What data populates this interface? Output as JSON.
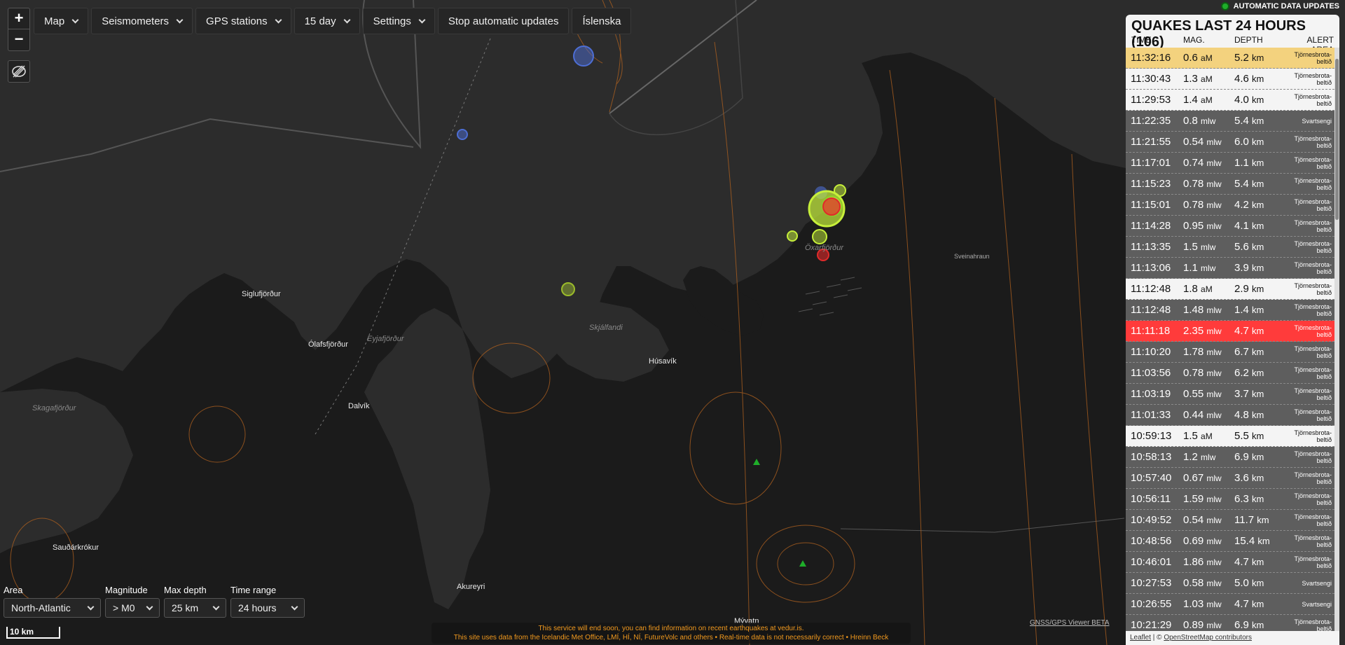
{
  "toolbar": {
    "zoom_in": "+",
    "zoom_out": "−",
    "buttons": [
      {
        "label": "Map",
        "dropdown": true
      },
      {
        "label": "Seismometers",
        "dropdown": true
      },
      {
        "label": "GPS stations",
        "dropdown": true
      },
      {
        "label": "15 day",
        "dropdown": true
      },
      {
        "label": "Settings",
        "dropdown": true
      },
      {
        "label": "Stop automatic updates",
        "dropdown": false
      },
      {
        "label": "Íslenska",
        "dropdown": false
      }
    ],
    "draw_icon": "draw-shape-icon"
  },
  "status": {
    "label": "AUTOMATIC DATA UPDATES",
    "color": "#1fae2a"
  },
  "panel": {
    "title": "QUAKES LAST 24 HOURS (106)",
    "columns": [
      "TIME",
      "MAG.",
      "DEPTH",
      "ALERT AREA"
    ],
    "rows": [
      {
        "time": "11:32:16",
        "mag": "0.6",
        "unit": "aM",
        "depth": "5.2",
        "area": "Tjörnesbrota-beltið",
        "style": "hl"
      },
      {
        "time": "11:30:43",
        "mag": "1.3",
        "unit": "aM",
        "depth": "4.6",
        "area": "Tjörnesbrota-beltið",
        "style": "light"
      },
      {
        "time": "11:29:53",
        "mag": "1.4",
        "unit": "aM",
        "depth": "4.0",
        "area": "Tjörnesbrota-beltið",
        "style": "light"
      },
      {
        "time": "11:22:35",
        "mag": "0.8",
        "unit": "mlw",
        "depth": "5.4",
        "area": "Svartsengi",
        "style": "dark"
      },
      {
        "time": "11:21:55",
        "mag": "0.54",
        "unit": "mlw",
        "depth": "6.0",
        "area": "Tjörnesbrota-beltið",
        "style": "dark"
      },
      {
        "time": "11:17:01",
        "mag": "0.74",
        "unit": "mlw",
        "depth": "1.1",
        "area": "Tjörnesbrota-beltið",
        "style": "dark"
      },
      {
        "time": "11:15:23",
        "mag": "0.78",
        "unit": "mlw",
        "depth": "5.4",
        "area": "Tjörnesbrota-beltið",
        "style": "dark"
      },
      {
        "time": "11:15:01",
        "mag": "0.78",
        "unit": "mlw",
        "depth": "4.2",
        "area": "Tjörnesbrota-beltið",
        "style": "dark"
      },
      {
        "time": "11:14:28",
        "mag": "0.95",
        "unit": "mlw",
        "depth": "4.1",
        "area": "Tjörnesbrota-beltið",
        "style": "dark"
      },
      {
        "time": "11:13:35",
        "mag": "1.5",
        "unit": "mlw",
        "depth": "5.6",
        "area": "Tjörnesbrota-beltið",
        "style": "dark"
      },
      {
        "time": "11:13:06",
        "mag": "1.1",
        "unit": "mlw",
        "depth": "3.9",
        "area": "Tjörnesbrota-beltið",
        "style": "dark"
      },
      {
        "time": "11:12:48",
        "mag": "1.8",
        "unit": "aM",
        "depth": "2.9",
        "area": "Tjörnesbrota-beltið",
        "style": "light"
      },
      {
        "time": "11:12:48",
        "mag": "1.48",
        "unit": "mlw",
        "depth": "1.4",
        "area": "Tjörnesbrota-beltið",
        "style": "dark"
      },
      {
        "time": "11:11:18",
        "mag": "2.35",
        "unit": "mlw",
        "depth": "4.7",
        "area": "Tjörnesbrota-beltið",
        "style": "red"
      },
      {
        "time": "11:10:20",
        "mag": "1.78",
        "unit": "mlw",
        "depth": "6.7",
        "area": "Tjörnesbrota-beltið",
        "style": "dark"
      },
      {
        "time": "11:03:56",
        "mag": "0.78",
        "unit": "mlw",
        "depth": "6.2",
        "area": "Tjörnesbrota-beltið",
        "style": "dark"
      },
      {
        "time": "11:03:19",
        "mag": "0.55",
        "unit": "mlw",
        "depth": "3.7",
        "area": "Tjörnesbrota-beltið",
        "style": "dark"
      },
      {
        "time": "11:01:33",
        "mag": "0.44",
        "unit": "mlw",
        "depth": "4.8",
        "area": "Tjörnesbrota-beltið",
        "style": "dark"
      },
      {
        "time": "10:59:13",
        "mag": "1.5",
        "unit": "aM",
        "depth": "5.5",
        "area": "Tjörnesbrota-beltið",
        "style": "light"
      },
      {
        "time": "10:58:13",
        "mag": "1.2",
        "unit": "mlw",
        "depth": "6.9",
        "area": "Tjörnesbrota-beltið",
        "style": "dark"
      },
      {
        "time": "10:57:40",
        "mag": "0.67",
        "unit": "mlw",
        "depth": "3.6",
        "area": "Tjörnesbrota-beltið",
        "style": "dark"
      },
      {
        "time": "10:56:11",
        "mag": "1.59",
        "unit": "mlw",
        "depth": "6.3",
        "area": "Tjörnesbrota-beltið",
        "style": "dark"
      },
      {
        "time": "10:49:52",
        "mag": "0.54",
        "unit": "mlw",
        "depth": "11.7",
        "area": "Tjörnesbrota-beltið",
        "style": "dark"
      },
      {
        "time": "10:48:56",
        "mag": "0.69",
        "unit": "mlw",
        "depth": "15.4",
        "area": "Tjörnesbrota-beltið",
        "style": "dark"
      },
      {
        "time": "10:46:01",
        "mag": "1.86",
        "unit": "mlw",
        "depth": "4.7",
        "area": "Tjörnesbrota-beltið",
        "style": "dark"
      },
      {
        "time": "10:27:53",
        "mag": "0.58",
        "unit": "mlw",
        "depth": "5.0",
        "area": "Svartsengi",
        "style": "dark"
      },
      {
        "time": "10:26:55",
        "mag": "1.03",
        "unit": "mlw",
        "depth": "4.7",
        "area": "Svartsengi",
        "style": "dark"
      },
      {
        "time": "10:21:29",
        "mag": "0.89",
        "unit": "mlw",
        "depth": "6.9",
        "area": "Tjörnesbrota-beltið",
        "style": "dark"
      }
    ],
    "depth_unit": "km"
  },
  "filters": [
    {
      "label": "Area",
      "value": "North-Atlantic"
    },
    {
      "label": "Magnitude",
      "value": "> M0"
    },
    {
      "label": "Max depth",
      "value": "25 km"
    },
    {
      "label": "Time range",
      "value": "24 hours"
    }
  ],
  "scale": "10 km",
  "notice": {
    "line1": "This service will end soon, you can find information on recent earthquakes at vedur.is.",
    "line2": "This site uses data from the Icelandic Met Office, LMÍ, HÍ, NÍ, FutureVolc and others • Real-time data is not necessarily correct • Hreinn Beck"
  },
  "gnss_link": "GNSS/GPS Viewer BETA",
  "attribution": {
    "leaflet": "Leaflet",
    "sep": " | © ",
    "osm": "OpenStreetMap contributors"
  },
  "places": [
    "Siglufjörður",
    "Ólafsfjörður",
    "Dalvík",
    "Húsavík",
    "Sauðárkrókur",
    "Akureyri",
    "Mývatn",
    "Sveinahraun"
  ],
  "water_labels": [
    "Eyjafjörður",
    "Skagafjörður",
    "Skjálfandi",
    "Öxarfjörður"
  ],
  "colors": {
    "map_bg": "#2b2b2b",
    "land": "#1c1c1c",
    "quake_recent": "#c6ef3a",
    "quake_red": "#e02a2a",
    "quake_blue": "#4d6ed4",
    "contour": "#b2621f"
  }
}
